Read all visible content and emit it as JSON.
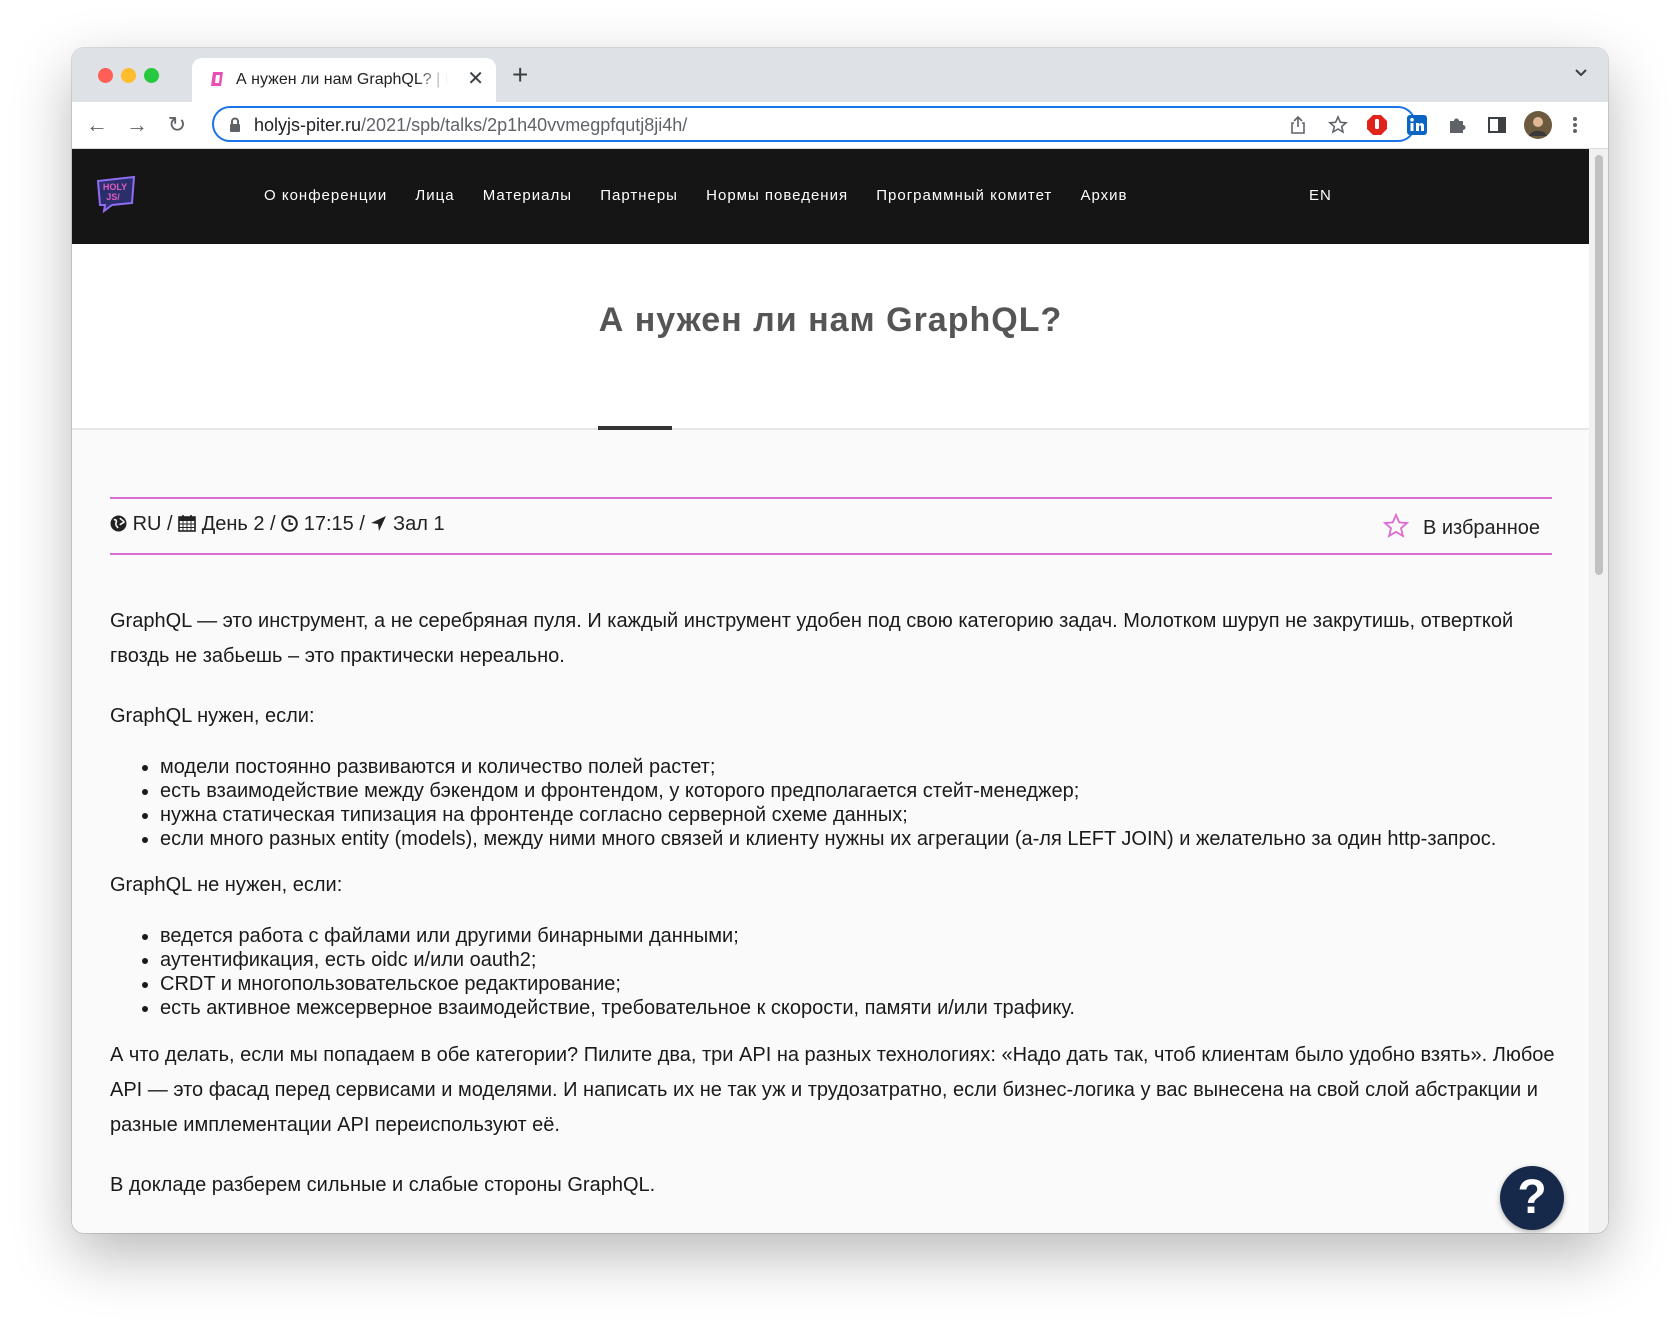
{
  "browser": {
    "tab_title": "А нужен ли нам GraphQL? | HolyJS",
    "url_host": "holyjs-piter.ru",
    "url_path": "/2021/spb/talks/2p1h40vvmegpfqutj8ji4h/"
  },
  "site": {
    "logo_text": "HOLY JS/",
    "nav": [
      "О конференции",
      "Лица",
      "Материалы",
      "Партнеры",
      "Нормы поведения",
      "Программный комитет",
      "Архив"
    ],
    "lang_switch": "EN"
  },
  "talk": {
    "title": "А нужен ли нам GraphQL?",
    "language": "RU",
    "day": "День 2",
    "time": "17:15",
    "hall": "Зал 1",
    "favorite_label": "В избранное"
  },
  "content": {
    "intro": "GraphQL — это инструмент, а не серебряная пуля. И каждый инструмент удобен под свою категорию задач. Молотком шуруп не закрутишь, отверткой гвоздь не забьешь – это практически нереально.",
    "need_heading": "GraphQL нужен, если:",
    "need_items": [
      "модели постоянно развиваются и количество полей растет;",
      "есть взаимодействие между бэкендом и фронтендом, у которого предполагается стейт-менеджер;",
      "нужна статическая типизация на фронтенде согласно серверной схеме данных;",
      "если много разных entity (models), между ними много связей и клиенту нужны их агрегации (а-ля LEFT JOIN) и желательно за один http-запрос."
    ],
    "not_need_heading": "GraphQL не нужен, если:",
    "not_need_items": [
      "ведется работа с файлами или другими бинарными данными;",
      "аутентификация, есть oidc и/или oauth2;",
      "CRDT и многопользовательское редактирование;",
      "есть активное межсерверное взаимодействие, требовательное к скорости, памяти и/или трафику."
    ],
    "both": "А что делать, если мы попадаем в обе категории? Пилите два, три API на разных технологиях: «Надо дать так, чтоб клиентам было удобно взять». Любое API — это фасад перед сервисами и моделями. И написать их не так уж и трудозатратно, если бизнес-логика у вас вынесена на свой слой абстракции и разные имплементации API переиспользуют её.",
    "outro": "В докладе разберем сильные и слабые стороны GraphQL."
  },
  "help_label": "?",
  "colors": {
    "header_bg": "#151515",
    "accent_pink": "#d86ed0",
    "help_bg": "#17294a",
    "omnibox_focus": "#1a73e8"
  }
}
